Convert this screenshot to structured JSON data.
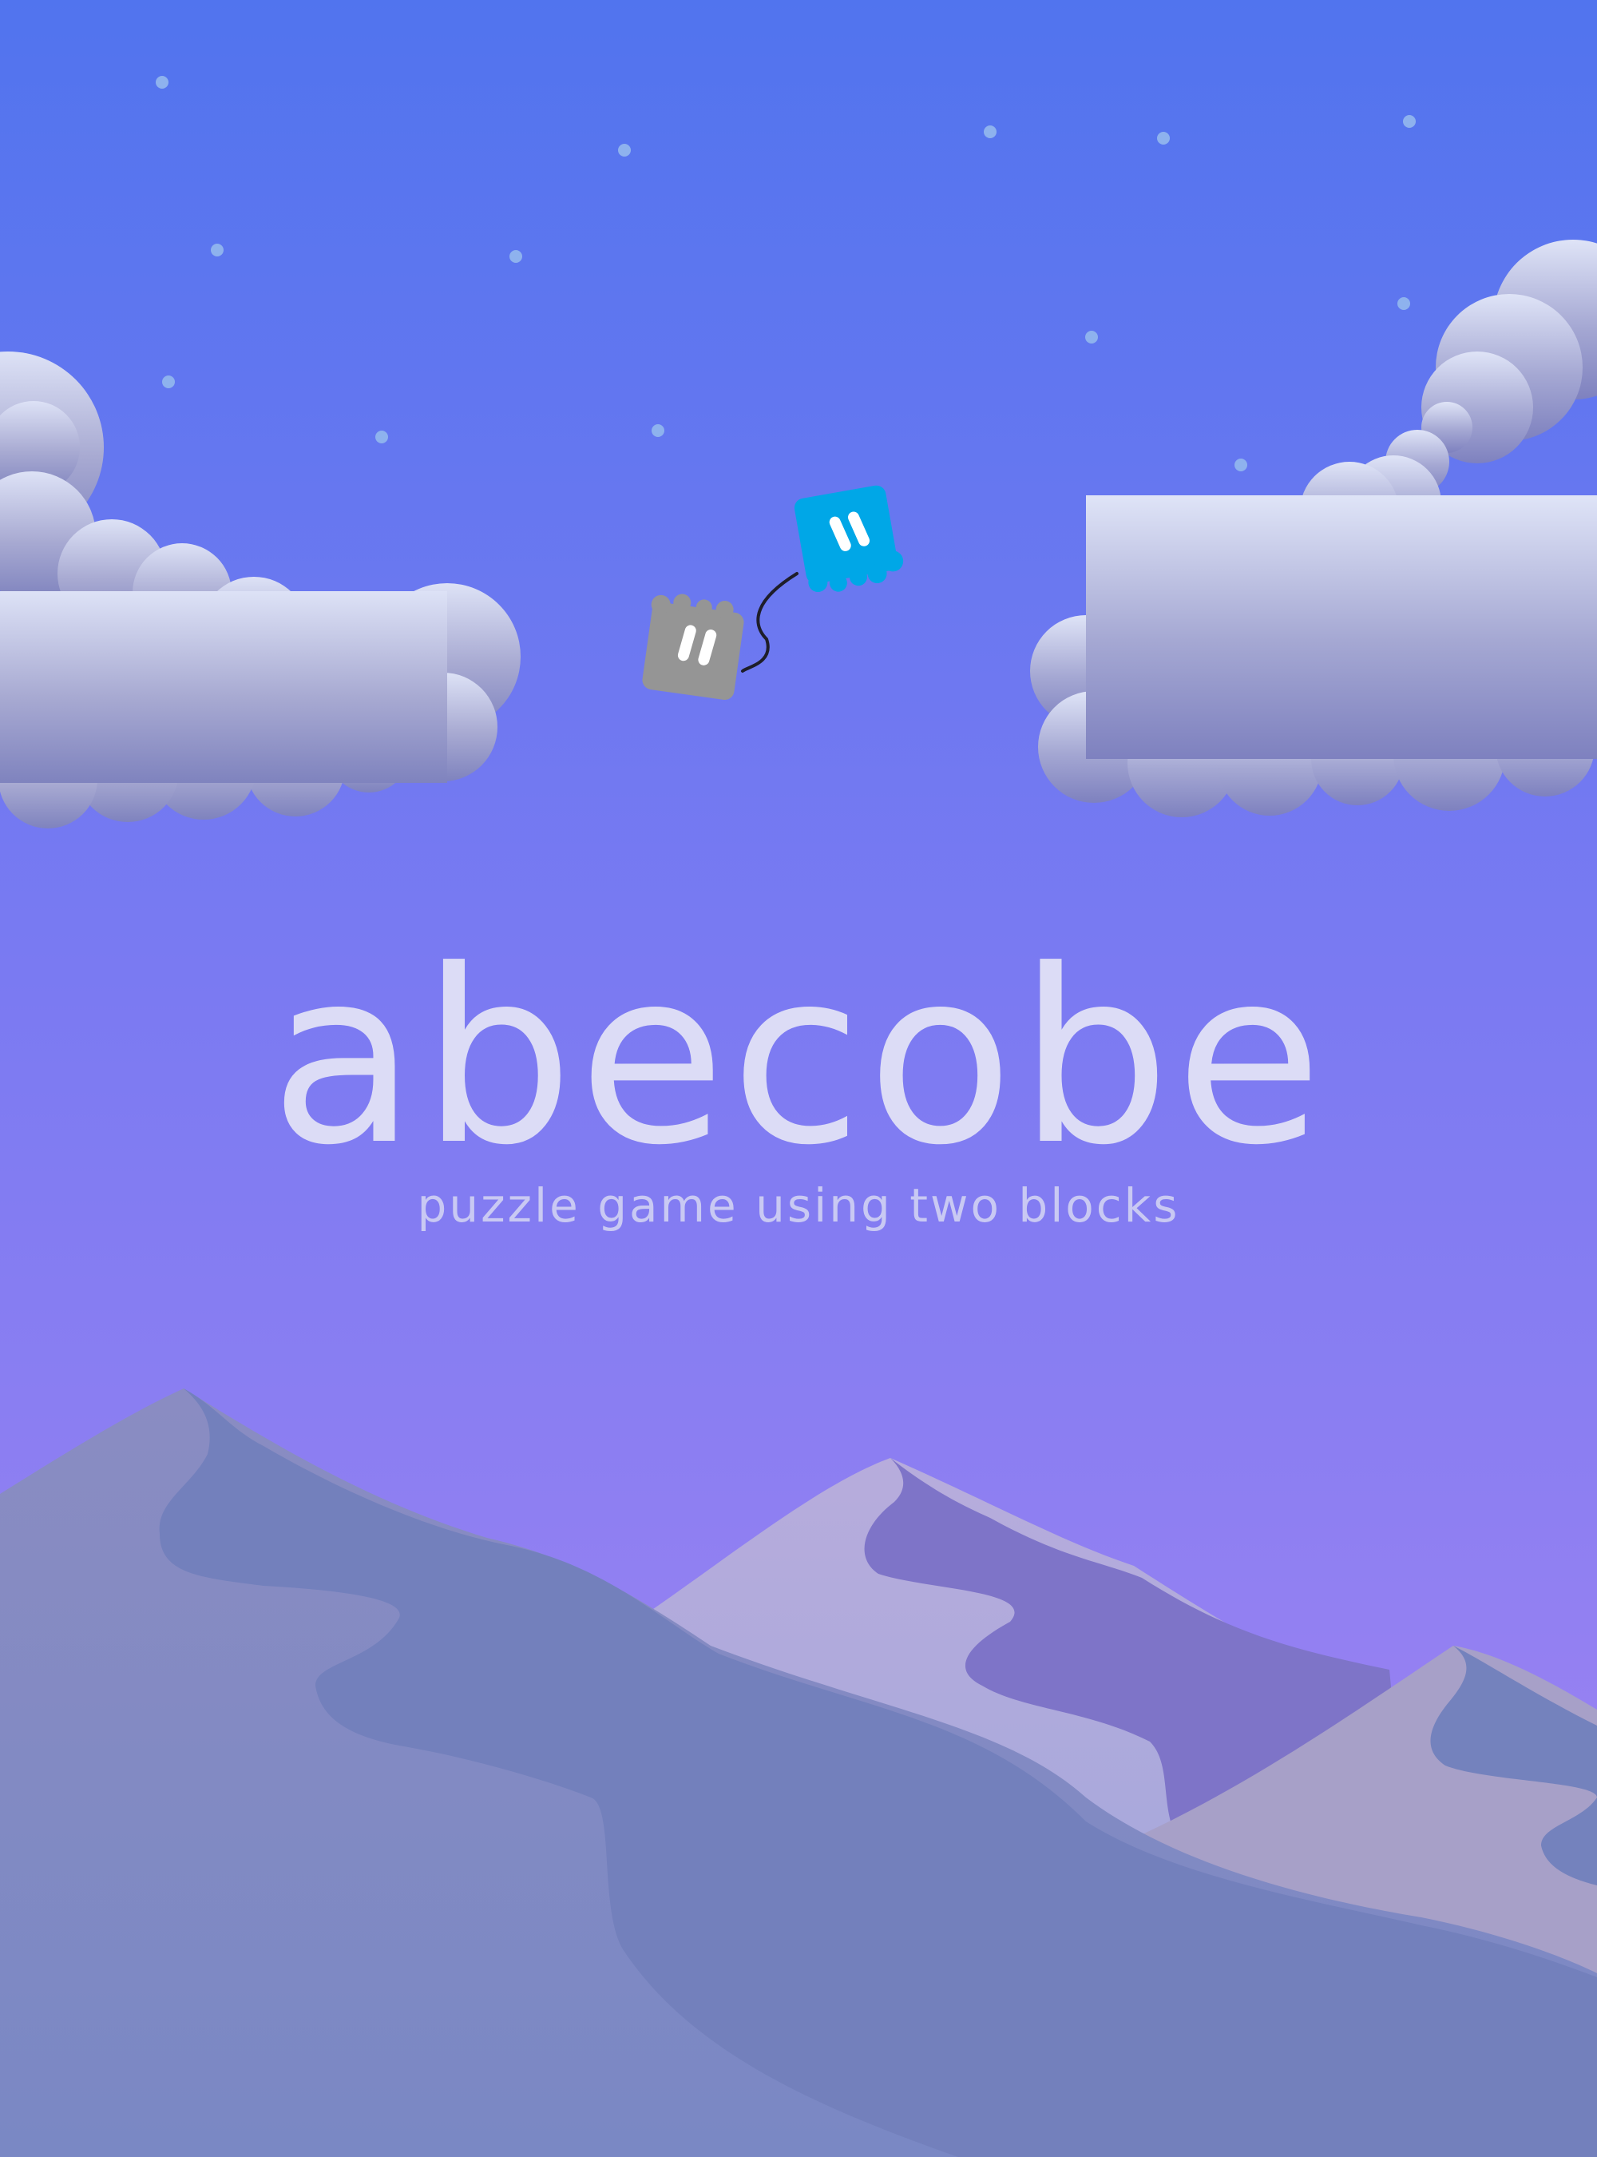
{
  "game": {
    "title": "abecobe",
    "tagline": "puzzle game using two blocks"
  },
  "icons": {
    "moon": "crescent-moon-icon",
    "blue_block": "blue-block-character-icon",
    "gray_block": "gray-block-character-icon"
  },
  "colors": {
    "sky_top": "#5174ee",
    "sky_bottom": "#9a82f2",
    "moon": "#d6daf6",
    "star": "#8eb2ee",
    "blue_block": "#00a7e7",
    "gray_block": "#959595",
    "title_text": "#dcdcf6",
    "tagline_text": "#c9c9f3"
  }
}
